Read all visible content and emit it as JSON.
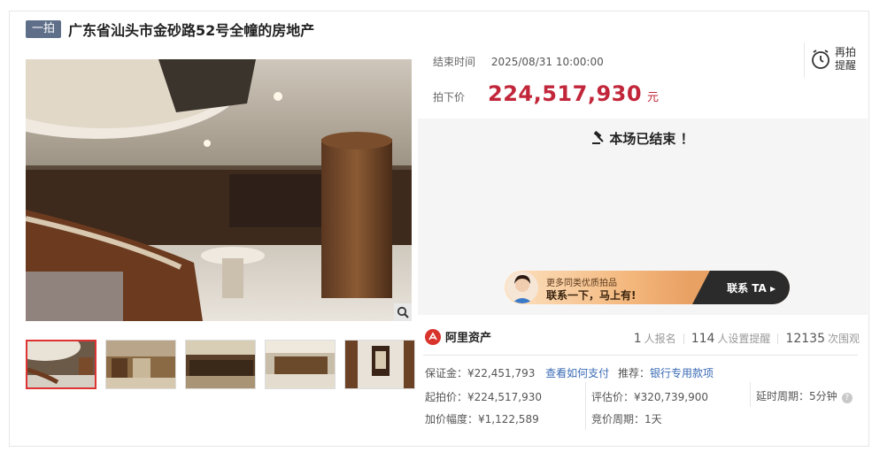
{
  "header": {
    "badge": "一拍",
    "title": "广东省汕头市金砂路52号全幢的房地产"
  },
  "auction": {
    "end_time_label": "结束时间",
    "end_time_value": "2025/08/31 10:00:00",
    "remind_label": "再拍提醒",
    "final_price_label": "拍下价",
    "final_price": "224,517,930",
    "currency_unit": "元",
    "status": "本场已结束 ！"
  },
  "banner": {
    "line1": "更多同类优质拍品",
    "line2": "联系一下，马上有!",
    "cta": "联系 TA ▸"
  },
  "seller": {
    "brand": "阿里资产"
  },
  "stats": {
    "signups": "1",
    "signups_label": "人报名",
    "reminders": "114",
    "reminders_label": "人设置提醒",
    "views": "12135",
    "views_label": "次围观"
  },
  "details": {
    "deposit": "保证金：¥22,451,793",
    "how_to_pay": "查看如何支付",
    "recommend_label": "推荐：",
    "recommend_link": "银行专用款项",
    "start_price": "起拍价：¥224,517,930",
    "appraisal": "评估价：¥320,739,900",
    "delay_period": "延时周期：5分钟",
    "increment": "加价幅度：¥1,122,589",
    "bid_period": "竞价周期：1天"
  },
  "icons": {
    "zoom": "magnifier-icon",
    "remind": "alarm-clock-icon",
    "gavel": "gavel-icon",
    "brand": "ali-asset-logo",
    "help": "question-icon"
  },
  "colors": {
    "price_red": "#c2263a",
    "link_blue": "#3a6bb5",
    "badge_bg": "#5f6f89",
    "active_thumb_border": "#dd3333"
  }
}
